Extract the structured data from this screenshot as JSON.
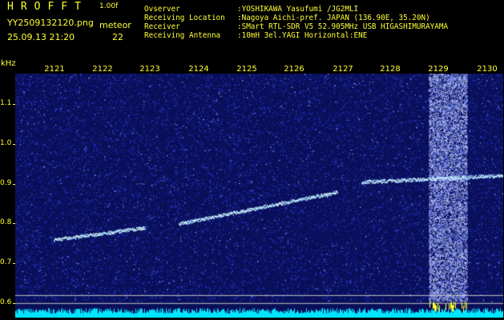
{
  "header": {
    "app_title": "HROFFT",
    "version": "1.00f",
    "filename": "YY2509132120.png",
    "datetime": "25.09.13 21:20",
    "meteor_label": "meteor",
    "meteor_count": "22"
  },
  "info": [
    {
      "label": "Ovserver",
      "value": ":YOSHIKAWA Yasufumi /JG2MLI"
    },
    {
      "label": "Receiving Location",
      "value": ":Nagoya Aichi-pref. JAPAN (136.90E, 35.20N)"
    },
    {
      "label": "Receiver",
      "value": ":SMart RTL-SDR V5 52.905MHz USB HIGASHIMURAYAMA"
    },
    {
      "label": "Receiving Antenna",
      "value": ":10mH 3el.YAGI Horizontal:ENE"
    }
  ],
  "chart_data": {
    "type": "heatmap",
    "ylabel": "kHz",
    "time_labels": [
      "2121",
      "2122",
      "2123",
      "2124",
      "2125",
      "2126",
      "2127",
      "2128",
      "2129",
      "2130"
    ],
    "y_ticks": [
      "1.1",
      "1.0",
      "0.9",
      "0.8",
      "0.7",
      "0.6"
    ],
    "ylim": [
      0.6,
      1.18
    ],
    "traces": [
      {
        "from_min": 0.0,
        "to_min": 1.9,
        "from_khz": 0.76,
        "to_khz": 0.79
      },
      {
        "from_min": 2.6,
        "to_min": 5.9,
        "from_khz": 0.8,
        "to_khz": 0.88
      },
      {
        "from_min": 6.4,
        "to_min": 9.9,
        "from_khz": 0.905,
        "to_khz": 0.925
      }
    ],
    "bright_band_minutes": [
      7.8,
      8.6
    ],
    "colors": {
      "background": "#0a0f5a",
      "noise": "#3c5cff",
      "signal": "#e6ffff",
      "baseline": "#00e5ff",
      "text": "#ffff33"
    }
  }
}
